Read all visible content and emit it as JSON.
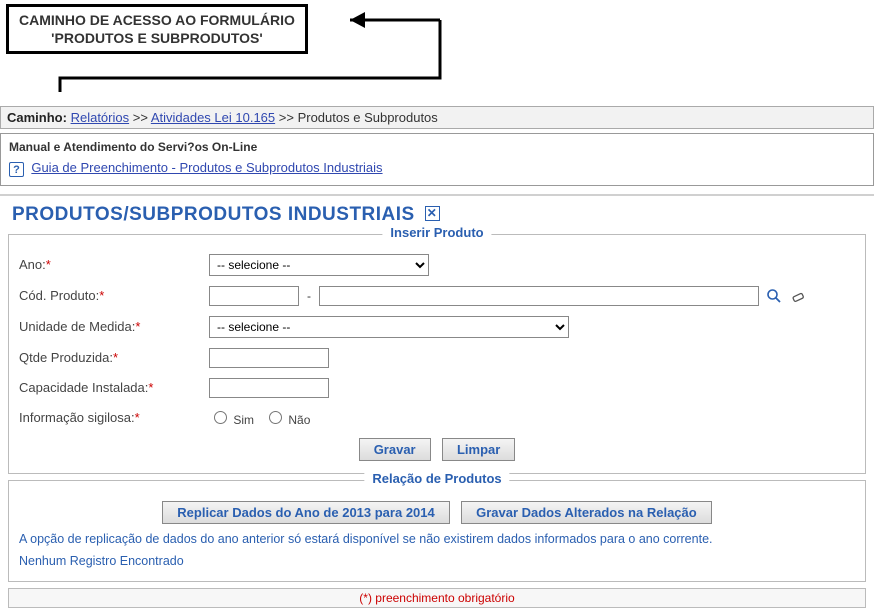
{
  "callout": {
    "line1": "CAMINHO DE ACESSO AO FORMULÁRIO",
    "line2": "'PRODUTOS E SUBPRODUTOS'"
  },
  "breadcrumb": {
    "label": "Caminho:",
    "link1": "Relatórios",
    "sep": ">>",
    "link2": "Atividades Lei 10.165",
    "tail": "Produtos e Subprodutos"
  },
  "manual": {
    "header": "Manual e Atendimento do Servi?os On-Line",
    "link": "Guia de Preenchimento - Produtos e Subprodutos Industriais"
  },
  "page_title": "PRODUTOS/SUBPRODUTOS INDUSTRIAIS",
  "form": {
    "legend": "Inserir Produto",
    "ano_label": "Ano:",
    "ano_placeholder": "-- selecione --",
    "cod_label": "Cód. Produto:",
    "cod_sep": "-",
    "um_label": "Unidade de Medida:",
    "um_placeholder": "-- selecione --",
    "qtde_label": "Qtde Produzida:",
    "cap_label": "Capacidade Instalada:",
    "sig_label": "Informação sigilosa:",
    "sim": "Sim",
    "nao": "Não",
    "gravar": "Gravar",
    "limpar": "Limpar"
  },
  "relacao": {
    "legend": "Relação de Produtos",
    "btn_replicar": "Replicar Dados do Ano de 2013 para 2014",
    "btn_gravar": "Gravar Dados Alterados na Relação",
    "info": "A opção de replicação de dados do ano anterior só estará disponível se não existirem dados informados para o ano corrente.",
    "empty": "Nenhum Registro Encontrado"
  },
  "footer": "(*) preenchimento obrigatório"
}
